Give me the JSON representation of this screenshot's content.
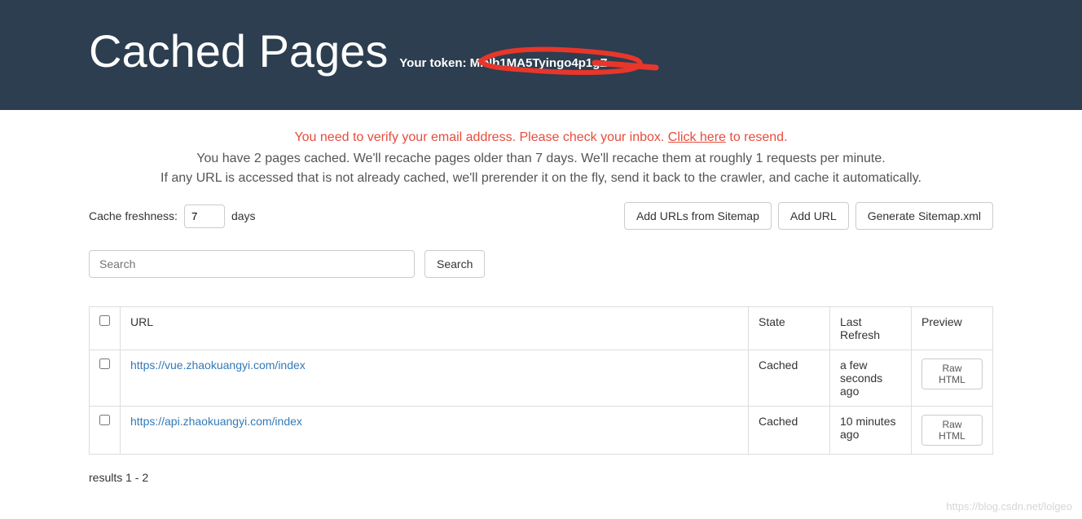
{
  "header": {
    "title": "Cached Pages",
    "token_label": "Your token:",
    "token_value": "MlNb1MA5Tyingo4p1gZ"
  },
  "alert": {
    "prefix": "You need to verify your email address. Please check your inbox. ",
    "link": "Click here",
    "suffix": " to resend."
  },
  "info": {
    "line1": "You have 2 pages cached. We'll recache pages older than 7 days. We'll recache them at roughly 1 requests per minute.",
    "line2": "If any URL is accessed that is not already cached, we'll prerender it on the fly, send it back to the crawler, and cache it automatically."
  },
  "freshness": {
    "label": "Cache freshness:",
    "value": "7",
    "unit": "days"
  },
  "buttons": {
    "add_sitemap": "Add URLs from Sitemap",
    "add_url": "Add URL",
    "generate_sitemap": "Generate Sitemap.xml",
    "search": "Search",
    "raw_html": "Raw HTML"
  },
  "search": {
    "placeholder": "Search"
  },
  "table": {
    "headers": {
      "url": "URL",
      "state": "State",
      "last_refresh": "Last Refresh",
      "preview": "Preview"
    },
    "rows": [
      {
        "url": "https://vue.zhaokuangyi.com/index",
        "state": "Cached",
        "last_refresh": "a few seconds ago"
      },
      {
        "url": "https://api.zhaokuangyi.com/index",
        "state": "Cached",
        "last_refresh": "10 minutes ago"
      }
    ]
  },
  "results": "results 1 - 2",
  "watermark": "https://blog.csdn.net/lolgeo"
}
